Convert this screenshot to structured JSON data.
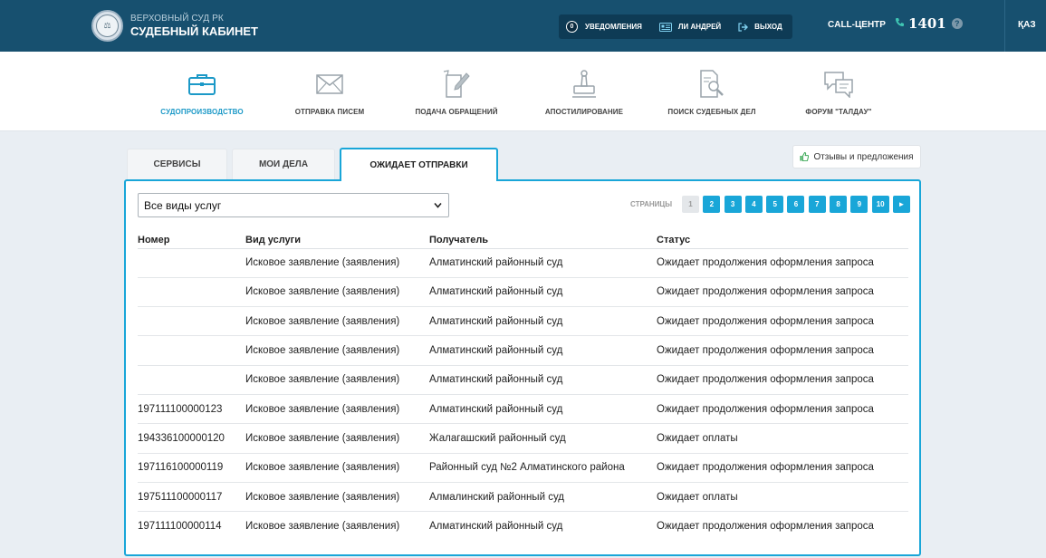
{
  "header": {
    "brand_top": "ВЕРХОВНЫЙ СУД РК",
    "brand_bottom": "СУДЕБНЫЙ КАБИНЕТ",
    "notifications_count": "0",
    "notifications_label": "УВЕДОМЛЕНИЯ",
    "user_label": "ЛИ АНДРЕЙ",
    "logout_label": "ВЫХОД",
    "call_center_label": "CALL-ЦЕНТР",
    "phone_number": "1401",
    "help_glyph": "?",
    "lang_label": "ҚАЗ"
  },
  "nav": {
    "items": [
      {
        "label": "СУДОПРОИЗВОДСТВО",
        "icon": "briefcase-icon",
        "active": true
      },
      {
        "label": "ОТПРАВКА ПИСЕМ",
        "icon": "envelope-icon",
        "active": false
      },
      {
        "label": "ПОДАЧА ОБРАЩЕНИЙ",
        "icon": "document-edit-icon",
        "active": false
      },
      {
        "label": "АПОСТИЛИРОВАНИЕ",
        "icon": "stamp-icon",
        "active": false
      },
      {
        "label": "ПОИСК СУДЕБНЫХ ДЕЛ",
        "icon": "document-search-icon",
        "active": false
      },
      {
        "label": "ФОРУМ \"ТАЛДАУ\"",
        "icon": "chat-bubbles-icon",
        "active": false
      }
    ]
  },
  "tabs": [
    {
      "label": "СЕРВИСЫ",
      "active": false
    },
    {
      "label": "МОИ ДЕЛА",
      "active": false
    },
    {
      "label": "ОЖИДАЕТ ОТПРАВКИ",
      "active": true
    }
  ],
  "feedback_label": "Отзывы и предложения",
  "filter": {
    "selected": "Все виды услуг"
  },
  "pagination": {
    "label": "СТРАНИЦЫ",
    "pages": [
      "1",
      "2",
      "3",
      "4",
      "5",
      "6",
      "7",
      "8",
      "9",
      "10"
    ],
    "current": "1",
    "next_glyph": "►"
  },
  "table": {
    "headers": [
      "Номер",
      "Вид услуги",
      "Получатель",
      "Статус"
    ],
    "rows": [
      [
        "",
        "Исковое заявление (заявления)",
        "Алматинский районный суд",
        "Ожидает продолжения оформления запроса"
      ],
      [
        "",
        "Исковое заявление (заявления)",
        "Алматинский районный суд",
        "Ожидает продолжения оформления запроса"
      ],
      [
        "",
        "Исковое заявление (заявления)",
        "Алматинский районный суд",
        "Ожидает продолжения оформления запроса"
      ],
      [
        "",
        "Исковое заявление (заявления)",
        "Алматинский районный суд",
        "Ожидает продолжения оформления запроса"
      ],
      [
        "",
        "Исковое заявление (заявления)",
        "Алматинский районный суд",
        "Ожидает продолжения оформления запроса"
      ],
      [
        "197111100000123",
        "Исковое заявление (заявления)",
        "Алматинский районный суд",
        "Ожидает продолжения оформления запроса"
      ],
      [
        "194336100000120",
        "Исковое заявление (заявления)",
        "Жалагашский районный суд",
        "Ожидает оплаты"
      ],
      [
        "197116100000119",
        "Исковое заявление (заявления)",
        "Районный суд №2 Алматинского района",
        "Ожидает продолжения оформления запроса"
      ],
      [
        "197511100000117",
        "Исковое заявление (заявления)",
        "Алмалинский районный суд",
        "Ожидает оплаты"
      ],
      [
        "197111100000114",
        "Исковое заявление (заявления)",
        "Алматинский районный суд",
        "Ожидает продолжения оформления запроса"
      ]
    ]
  },
  "colors": {
    "header_bg": "#17506f",
    "accent": "#19a6d8",
    "active_nav": "#1c99c7"
  }
}
